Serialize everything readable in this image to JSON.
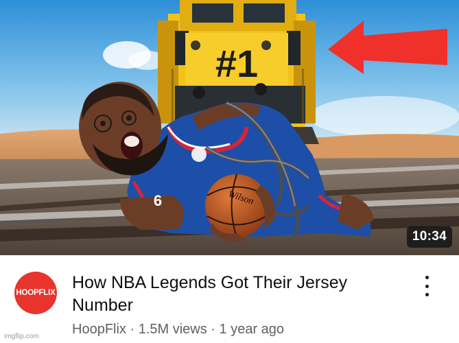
{
  "video": {
    "duration": "10:34",
    "title": "How NBA Legends Got Their Jersey Number",
    "channel_avatar_text": "HOOPFLIX",
    "channel": "HoopFlix",
    "separator": " · ",
    "views": "1.5M views",
    "age": "1 year ago",
    "thumbnail_text": {
      "train_label": "#1",
      "jersey_number": "6",
      "ball_brand": "Wilson"
    }
  },
  "menu_icon": "more-vert-icon",
  "watermark": "imgflip.com",
  "colors": {
    "avatar": "#e8342c",
    "arrow": "#f0302a",
    "train": "#f2c21b",
    "jersey_blue": "#1d4fa8",
    "jersey_red": "#d8233a"
  }
}
